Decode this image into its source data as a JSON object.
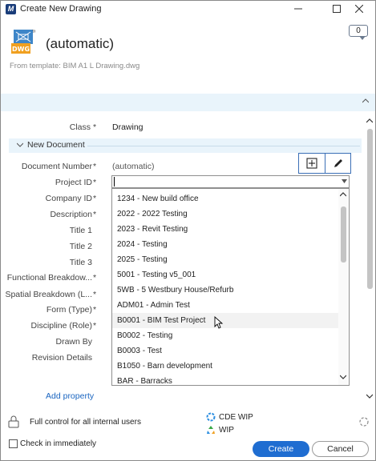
{
  "window": {
    "title": "Create New Drawing",
    "app_icon_letter": "M"
  },
  "header": {
    "file_type": "DWG",
    "document_name": "(automatic)",
    "template_line": "From template: BIM A1 L Drawing.dwg",
    "comment_count": "0"
  },
  "form": {
    "class_label": "Class",
    "class_value": "Drawing",
    "section_title": "New Document",
    "fields": [
      {
        "label": "Document Number",
        "required": true,
        "value": "(automatic)"
      },
      {
        "label": "Project ID",
        "required": true,
        "value": ""
      },
      {
        "label": "Company ID",
        "required": true,
        "value": ""
      },
      {
        "label": "Description",
        "required": true,
        "value": ""
      },
      {
        "label": "Title 1",
        "required": false,
        "value": ""
      },
      {
        "label": "Title 2",
        "required": false,
        "value": ""
      },
      {
        "label": "Title 3",
        "required": false,
        "value": ""
      },
      {
        "label": "Functional Breakdow...",
        "required": true,
        "value": ""
      },
      {
        "label": "Spatial Breakdown (L...",
        "required": true,
        "value": ""
      },
      {
        "label": "Form (Type)",
        "required": true,
        "value": ""
      },
      {
        "label": "Discipline (Role)",
        "required": true,
        "value": ""
      },
      {
        "label": "Drawn By",
        "required": false,
        "value": ""
      },
      {
        "label": "Revision Details",
        "required": false,
        "value": ""
      }
    ],
    "add_property": "Add property"
  },
  "project_dropdown": {
    "items": [
      "1234 - New build office",
      "2022 - 2022 Testing",
      "2023 - Revit Testing",
      "2024 - Testing",
      "2025 - Testing",
      "5001 - Testing v5_001",
      "5WB - 5 Westbury House/Refurb",
      "ADM01 - Admin Test",
      "B0001 - BIM Test Project",
      "B0002 - Testing",
      "B0003 - Test",
      "B1050 - Barn development",
      "BAR - Barracks"
    ],
    "hovered_index": 8
  },
  "footer": {
    "permissions": "Full control for all internal users",
    "workflow_1": "CDE WIP",
    "workflow_2": "WIP",
    "check_in_label": "Check in immediately",
    "create_label": "Create",
    "cancel_label": "Cancel"
  },
  "colors": {
    "accent": "#1f6dd1",
    "band": "#e9f4fb",
    "link": "#1a65c0",
    "dwg_orange": "#f0a020",
    "dwg_blue": "#3e86c8"
  }
}
